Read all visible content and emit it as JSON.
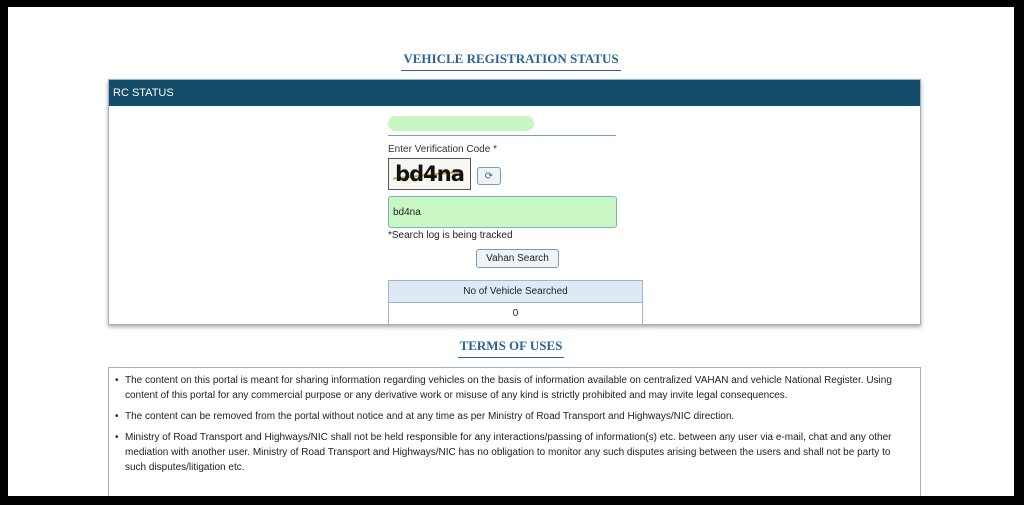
{
  "page": {
    "title": "VEHICLE REGISTRATION STATUS"
  },
  "rc_panel": {
    "header": "RC STATUS",
    "verification_label": "Enter Verification Code",
    "required_mark": "*",
    "captcha_text": "bd4na",
    "refresh_icon": "refresh-icon",
    "input_value": "bd4na",
    "track_note": "*Search log is being tracked",
    "search_button": "Vahan Search",
    "count_header": "No of Vehicle Searched",
    "count_value": "0"
  },
  "terms": {
    "title": "TERMS OF USES",
    "items": [
      "The content on this portal is meant for sharing information regarding vehicles on the basis of information available on centralized VAHAN and vehicle National Register. Using content of this portal for any commercial purpose or any derivative work or misuse of any kind is strictly prohibited and may invite legal consequences.",
      "The content can be removed from the portal without notice and at any time as per Ministry of Road Transport and Highways/NIC direction.",
      "Ministry of Road Transport and Highways/NIC shall not be held responsible for any interactions/passing of information(s) etc. between any user via e-mail, chat and any other mediation with another user. Ministry of Road Transport and Highways/NIC has no obligation to monitor any such disputes arising between the users and shall not be party to such disputes/litigation etc."
    ]
  },
  "colors": {
    "header_bg": "#134d6a",
    "title_color": "#2a6496",
    "input_bg": "#c8f7c3"
  }
}
